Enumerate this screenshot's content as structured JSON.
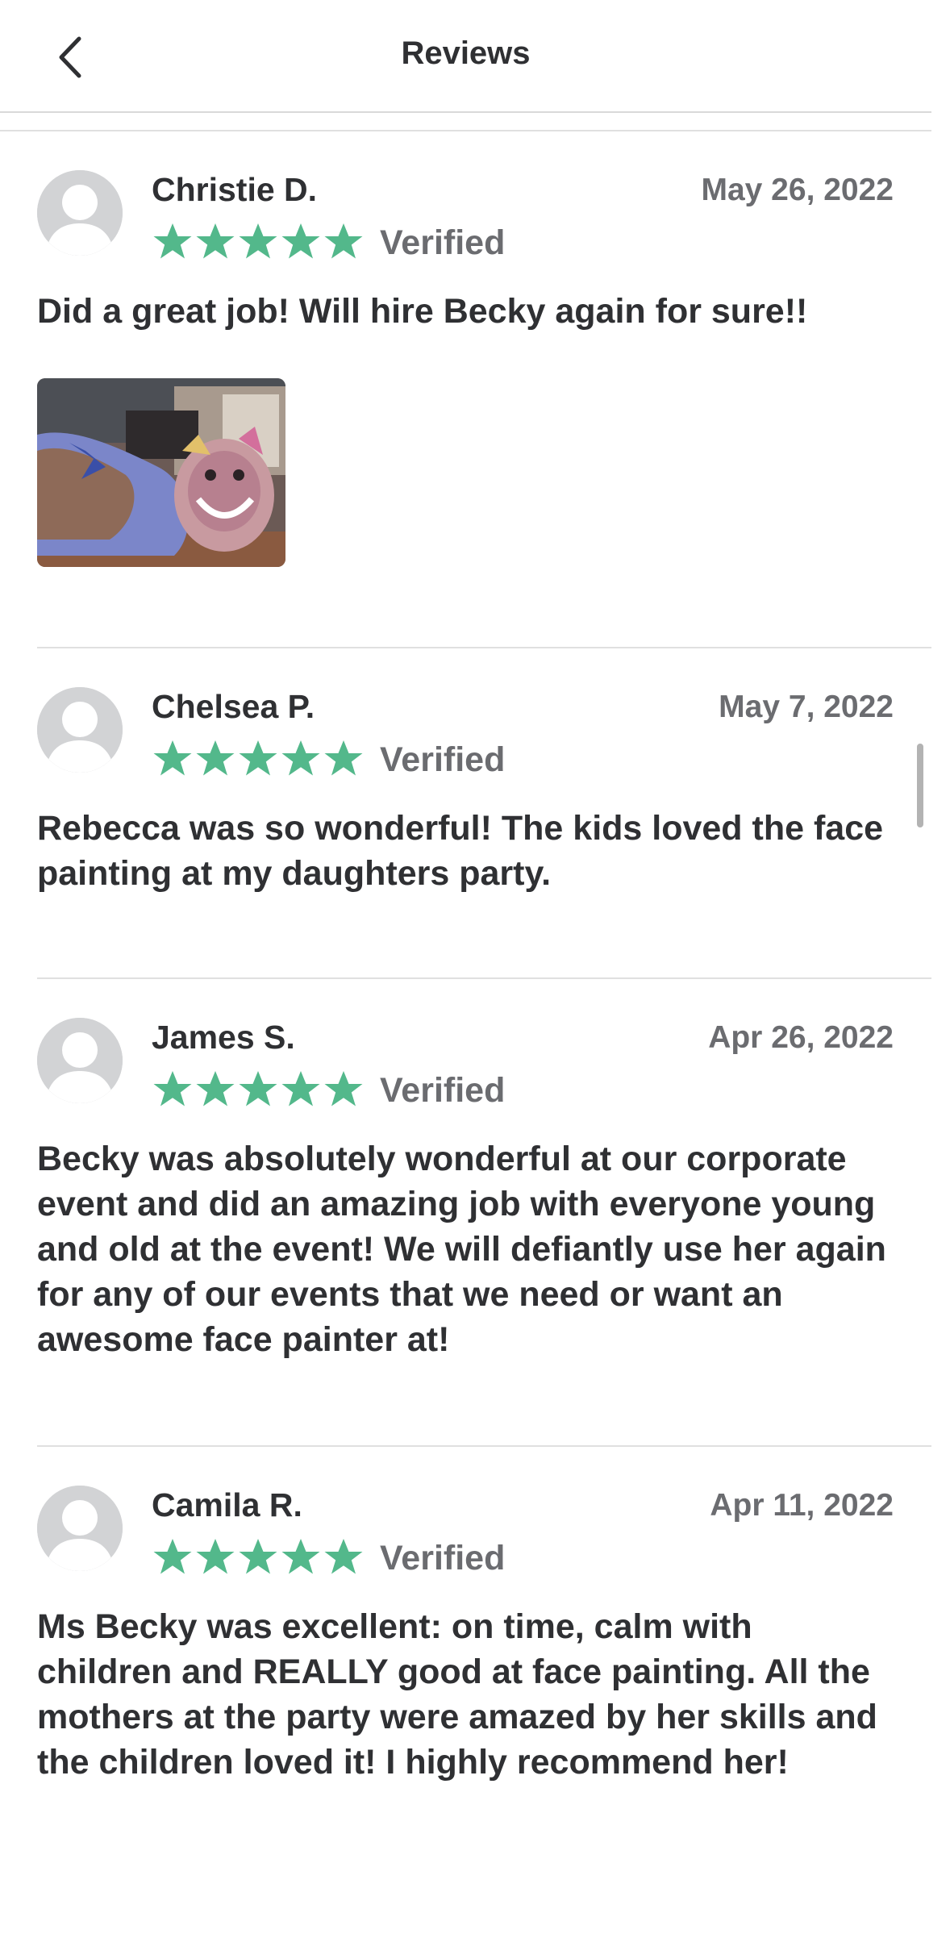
{
  "header": {
    "title": "Reviews",
    "back_icon": "chevron-left-icon"
  },
  "colors": {
    "star": "#53b88b",
    "text": "#2f3033",
    "muted": "#6b6c70",
    "avatar": "#d2d3d5"
  },
  "reviews": [
    {
      "name": "Christie D.",
      "date": "May 26, 2022",
      "rating": 5,
      "verified": "Verified",
      "text": "Did a great job! Will hire Becky again for sure!!",
      "has_photo": true
    },
    {
      "name": "Chelsea P.",
      "date": "May 7, 2022",
      "rating": 5,
      "verified": "Verified",
      "text": "Rebecca was so wonderful! The kids loved the face painting at my daughters party.",
      "has_photo": false
    },
    {
      "name": "James S.",
      "date": "Apr 26, 2022",
      "rating": 5,
      "verified": "Verified",
      "text": "Becky was absolutely wonderful at our corporate event and did an amazing job with everyone young and old at the event! We will defiantly use her again for any of our events that we need or want an awesome face painter at!",
      "has_photo": false
    },
    {
      "name": "Camila R.",
      "date": "Apr 11, 2022",
      "rating": 5,
      "verified": "Verified",
      "text": "Ms Becky was excellent: on time, calm with children and REALLY good at face painting. All the mothers at the party were amazed by her skills and the children loved it! I highly recommend her!",
      "has_photo": false
    }
  ]
}
